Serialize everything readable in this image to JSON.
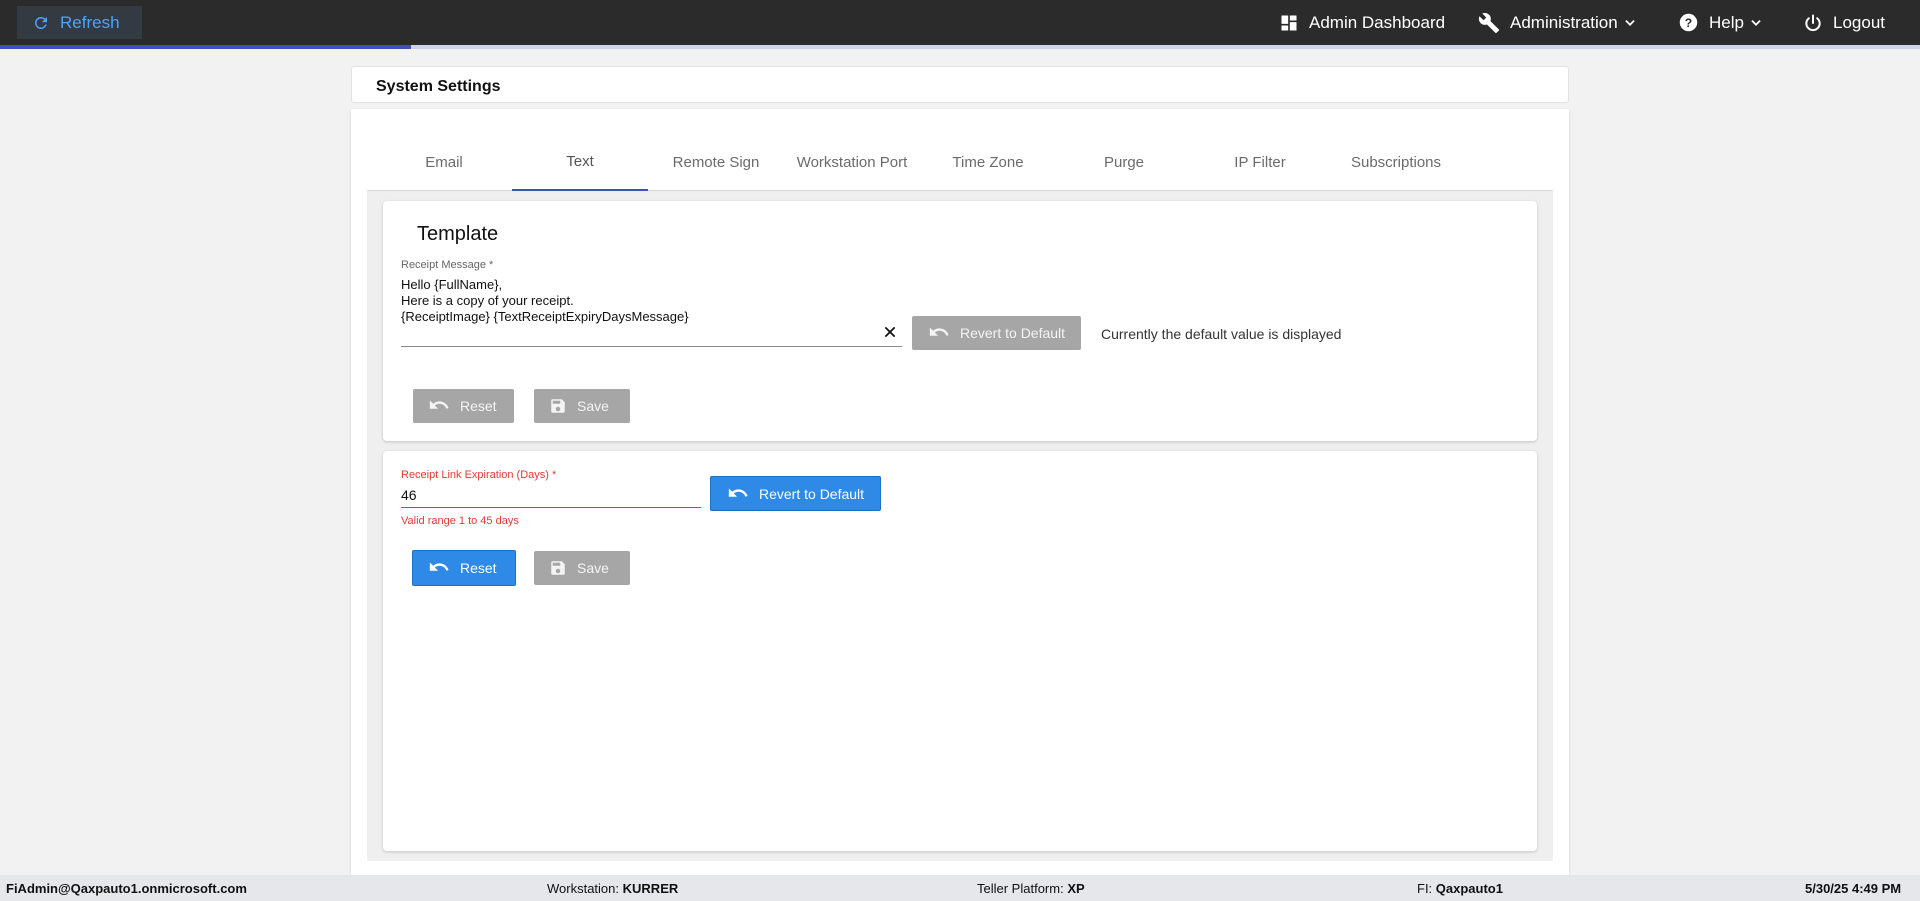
{
  "topbar": {
    "refresh_label": "Refresh",
    "nav": {
      "admin_dashboard": "Admin Dashboard",
      "administration": "Administration",
      "help": "Help",
      "logout": "Logout"
    },
    "load_progress": 0.214
  },
  "page_title": "System Settings",
  "tabs": [
    "Email",
    "Text",
    "Remote Sign",
    "Workstation Port",
    "Time Zone",
    "Purge",
    "IP Filter",
    "Subscriptions"
  ],
  "active_tab": "Text",
  "template_panel": {
    "title": "Template",
    "receipt_message_label": "Receipt Message *",
    "receipt_message_value": "Hello {FullName},\nHere is a copy of your receipt.\n{ReceiptImage} {TextReceiptExpiryDaysMessage}",
    "revert_label": "Revert to Default",
    "default_notice": "Currently the default value is displayed",
    "reset_label": "Reset",
    "save_label": "Save"
  },
  "expiration_panel": {
    "label": "Receipt Link Expiration (Days) *",
    "value": "46",
    "error_text": "Valid range 1 to 45 days",
    "revert_label": "Revert to Default",
    "reset_label": "Reset",
    "save_label": "Save"
  },
  "footer": {
    "user": "FiAdmin@Qaxpauto1.onmicrosoft.com",
    "workstation_label": "Workstation:",
    "workstation_value": "KURRER",
    "teller_label": "Teller Platform:",
    "teller_value": "XP",
    "fi_label": "FI:",
    "fi_value": "Qaxpauto1",
    "datetime": "5/30/25 4:49 PM"
  },
  "colors": {
    "topbar": "#2b2b2b",
    "accent": "#3f51b5",
    "primary_button": "#2e8ae6",
    "disabled_button": "#a6a6a6",
    "error": "#e53935"
  }
}
